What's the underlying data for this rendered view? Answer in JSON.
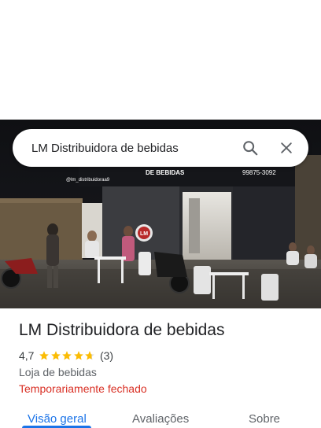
{
  "search": {
    "value": "LM Distribuidora de bebidas"
  },
  "place": {
    "name": "LM Distribuidora de bebidas",
    "rating": "4,7",
    "stars": 4.7,
    "review_count": "(3)",
    "category": "Loja de bebidas",
    "status": "Temporariamente fechado"
  },
  "photo_sign": {
    "subtitle": "DE BEBIDAS",
    "phone": "99875-3092",
    "handle": "@lm_distribuidoraa9",
    "logo": "LM"
  },
  "tabs": [
    {
      "label": "Visão geral",
      "active": true
    },
    {
      "label": "Avaliações",
      "active": false
    },
    {
      "label": "Sobre",
      "active": false
    }
  ],
  "colors": {
    "accent": "#1a73e8",
    "star": "#fbbc04",
    "status_closed": "#d93025"
  },
  "icons": [
    "search-icon",
    "close-icon",
    "star-icon"
  ]
}
